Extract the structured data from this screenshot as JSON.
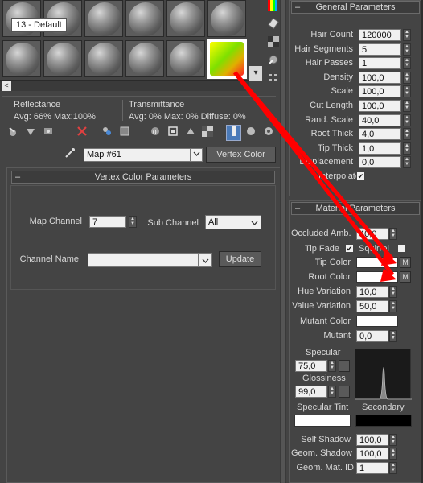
{
  "tooltip": "13 - Default",
  "slots": {
    "nav_left": "<"
  },
  "side_icons": {
    "expand": "▾"
  },
  "stats": {
    "reflectance_label": "Reflectance",
    "reflectance_values": "Avg: 66% Max:100%",
    "transmittance_label": "Transmittance",
    "transmittance_values": "Avg:   0% Max:   0%  Diffuse:   0%"
  },
  "map_row": {
    "map_name": "Map #61",
    "map_type": "Vertex Color"
  },
  "vertex_params": {
    "title": "Vertex Color Parameters",
    "map_channel_label": "Map Channel",
    "map_channel_value": "7",
    "sub_channel_label": "Sub Channel",
    "sub_channel_value": "All",
    "channel_name_label": "Channel Name",
    "channel_name_value": "",
    "update_label": "Update"
  },
  "general": {
    "title": "General Parameters",
    "rows": [
      {
        "label": "Hair Count",
        "value": "120000"
      },
      {
        "label": "Hair Segments",
        "value": "5"
      },
      {
        "label": "Hair Passes",
        "value": "1"
      },
      {
        "label": "Density",
        "value": "100,0"
      },
      {
        "label": "Scale",
        "value": "100,0"
      },
      {
        "label": "Cut Length",
        "value": "100,0"
      },
      {
        "label": "Rand. Scale",
        "value": "40,0"
      },
      {
        "label": "Root Thick",
        "value": "4,0"
      },
      {
        "label": "Tip Thick",
        "value": "1,0"
      },
      {
        "label": "Displacement",
        "value": "0,0"
      }
    ],
    "interpolate_label": "Interpolate",
    "interpolate_checked": "✔"
  },
  "material": {
    "title": "Material Parameters",
    "occluded_label": "Occluded Amb.",
    "occluded_value": "40,0",
    "tipfade_label": "Tip Fade",
    "tipfade_checked": "✔",
    "squirrel_label": "Squirrel",
    "tip_color_label": "Tip Color",
    "root_color_label": "Root Color",
    "m_label": "M",
    "hue_variation_label": "Hue Variation",
    "hue_variation_value": "10,0",
    "value_variation_label": "Value Variation",
    "value_variation_value": "50,0",
    "mutant_color_label": "Mutant Color",
    "mutant_label": "Mutant",
    "mutant_value": "0,0",
    "specular_label": "Specular",
    "specular_value": "75,0",
    "glossiness_label": "Glossiness",
    "glossiness_value": "99,0",
    "specular_tint_label": "Specular Tint",
    "secondary_label": "Secondary",
    "self_shadow_label": "Self Shadow",
    "self_shadow_value": "100,0",
    "geom_shadow_label": "Geom. Shadow",
    "geom_shadow_value": "100,0",
    "geom_mat_id_label": "Geom. Mat. ID",
    "geom_mat_id_value": "1"
  },
  "colors": {
    "arrow": "#ff0000",
    "panel_bg": "#444444",
    "field_bg": "#f0f0f0"
  }
}
